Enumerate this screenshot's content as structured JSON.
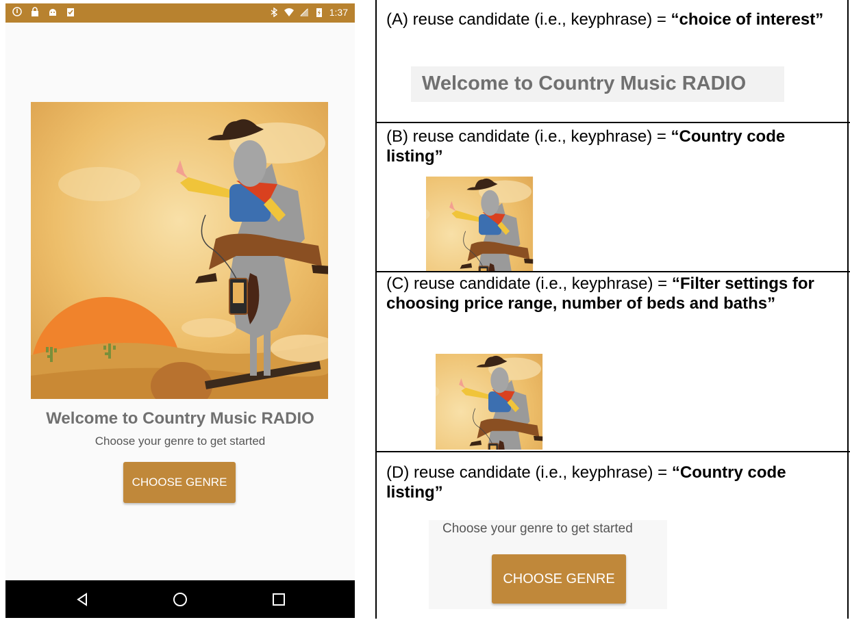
{
  "phone": {
    "status_bar": {
      "time": "1:37",
      "left_icons": [
        "info-icon",
        "lock-icon",
        "android-icon",
        "clipboard-check-icon"
      ],
      "right_icons": [
        "bluetooth-icon",
        "wifi-icon",
        "no-signal-icon",
        "battery-icon"
      ],
      "color": "#b8822f"
    },
    "welcome_title": "Welcome to Country Music RADIO",
    "subtitle": "Choose your genre to get started",
    "choose_button_label": "CHOOSE GENRE",
    "accent_color": "#c0883a",
    "nav_icons": [
      "back-icon",
      "home-icon",
      "recents-icon"
    ]
  },
  "cells": [
    {
      "prefix": "(A) reuse candidate (i.e., keyphrase) = ",
      "keyphrase": "“choice of interest”",
      "crop_text": "Welcome to Country Music RADIO"
    },
    {
      "prefix": "(B)  reuse candidate (i.e., keyphrase) = ",
      "keyphrase": "“Country code listing”"
    },
    {
      "prefix": "(C)  reuse candidate (i.e., keyphrase) = ",
      "keyphrase": "“Filter settings for choosing price range, number of beds and baths”"
    },
    {
      "prefix": "(D)  reuse candidate (i.e., keyphrase) = ",
      "keyphrase": "“Country code listing”",
      "crop_subtitle": "Choose your genre to get started",
      "crop_button": "CHOOSE GENRE"
    }
  ]
}
